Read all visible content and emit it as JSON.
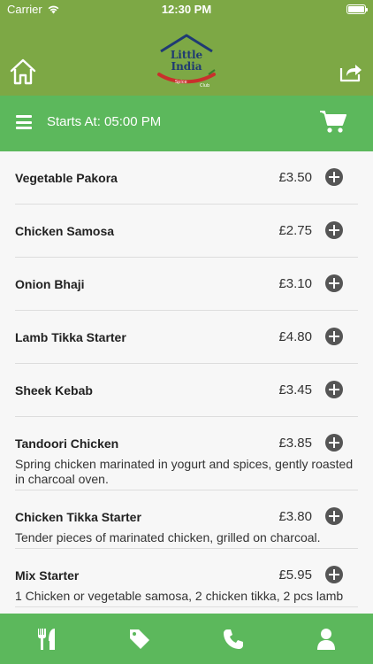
{
  "status_bar": {
    "carrier": "Carrier",
    "time": "12:30 PM"
  },
  "logo": {
    "line1": "Little",
    "line2": "India",
    "tag1": "Spice",
    "tag2": "Club"
  },
  "category_bar": {
    "title": "Starts At: 05:00 PM"
  },
  "menu_items": [
    {
      "name": "Vegetable Pakora",
      "price": "£3.50",
      "description": ""
    },
    {
      "name": "Chicken Samosa",
      "price": "£2.75",
      "description": ""
    },
    {
      "name": "Onion Bhaji",
      "price": "£3.10",
      "description": ""
    },
    {
      "name": "Lamb Tikka Starter",
      "price": "£4.80",
      "description": ""
    },
    {
      "name": "Sheek Kebab",
      "price": "£3.45",
      "description": ""
    },
    {
      "name": "Tandoori Chicken",
      "price": "£3.85",
      "description": "Spring chicken marinated in yogurt and spices, gently roasted in charcoal oven."
    },
    {
      "name": "Chicken Tikka Starter",
      "price": "£3.80",
      "description": "Tender pieces of marinated chicken, grilled on charcoal."
    },
    {
      "name": "Mix Starter",
      "price": "£5.95",
      "description": "1 Chicken or vegetable samosa, 2 chicken tikka, 2 pcs lamb"
    }
  ],
  "tab_bar": [
    "menu-tab",
    "offers-tab",
    "call-tab",
    "account-tab"
  ],
  "colors": {
    "header": "#7da845",
    "bar": "#5cb85c",
    "add_button": "#555555"
  }
}
